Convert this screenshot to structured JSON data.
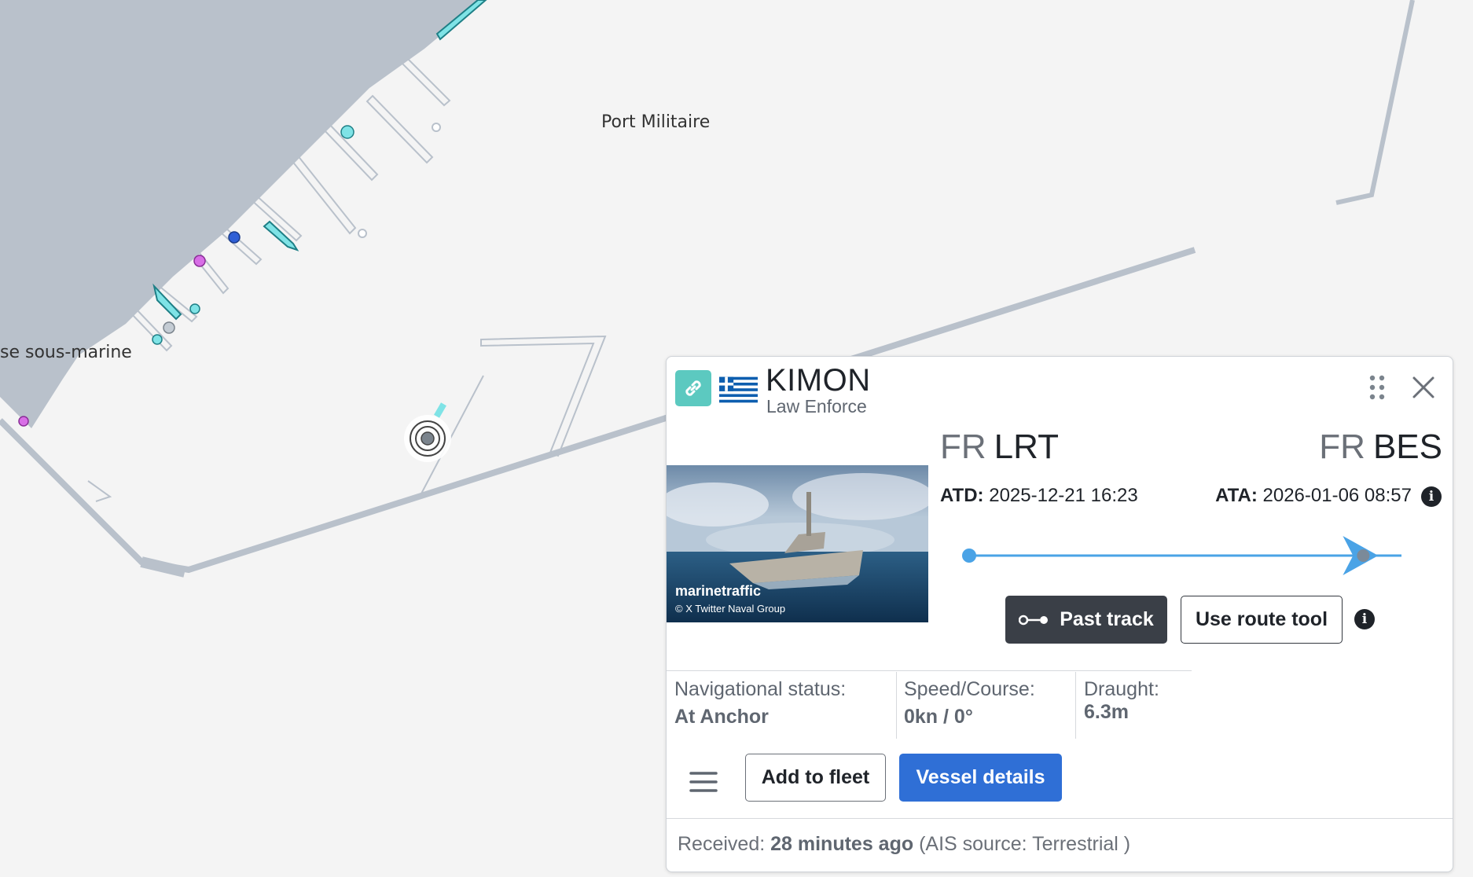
{
  "map": {
    "labels": {
      "port_militaire": "Port Militaire",
      "base_sous_marine": "se sous-marine"
    }
  },
  "panel": {
    "vessel_name": "KIMON",
    "vessel_type": "Law Enforce",
    "flag_icon": "greece-flag-icon",
    "origin": {
      "country": "FR",
      "port": "LRT"
    },
    "destination": {
      "country": "FR",
      "port": "BES"
    },
    "atd_label": "ATD:",
    "atd_value": "2025-12-21 16:23",
    "ata_label": "ATA:",
    "ata_value": "2026-01-06 08:57",
    "photo_watermark": "marinetraffic",
    "photo_credit": "© X  Twitter Naval Group",
    "past_track_label": "Past track",
    "route_tool_label": "Use route tool",
    "nav_status_label": "Navigational status:",
    "nav_status_value": "At Anchor",
    "speed_label": "Speed/Course:",
    "speed_value": "0kn / 0°",
    "draught_label": "Draught:",
    "draught_value": "6.3m",
    "add_fleet_label": "Add to fleet",
    "vessel_details_label": "Vessel details",
    "received_label": "Received:",
    "received_value": "28 minutes ago",
    "ais_source": "(AIS source: Terrestrial )",
    "progress": 0.92
  },
  "colors": {
    "accent_blue": "#2f6fd6",
    "route_line": "#4aa3e6",
    "link_teal": "#5cc9c0",
    "dark_button": "#3a3f47",
    "land": "#b9c1cb"
  }
}
